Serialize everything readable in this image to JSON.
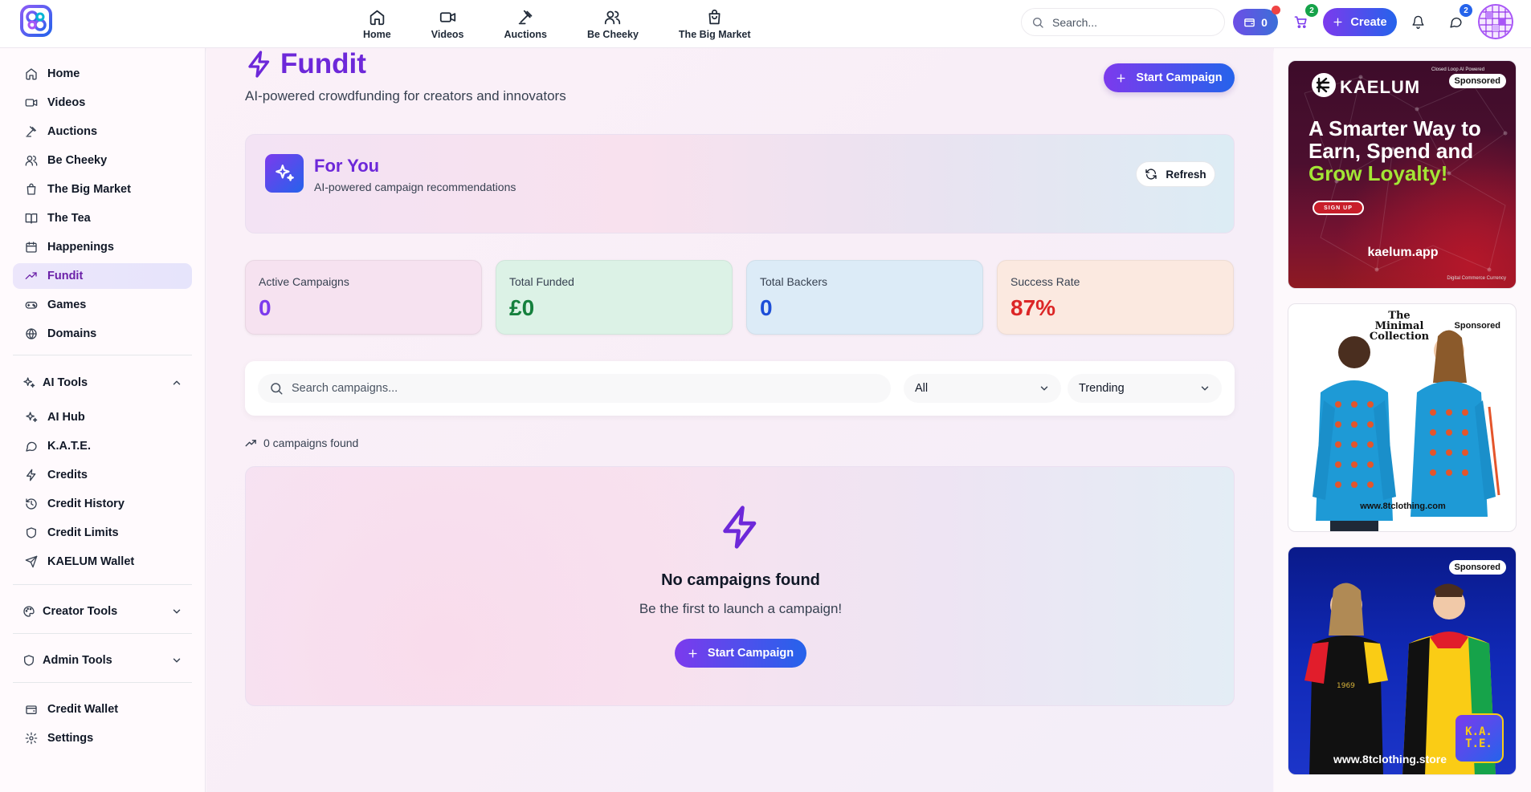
{
  "topbar": {
    "nav": [
      {
        "label": "Home",
        "icon": "home-icon"
      },
      {
        "label": "Videos",
        "icon": "video-icon"
      },
      {
        "label": "Auctions",
        "icon": "gavel-icon"
      },
      {
        "label": "Be Cheeky",
        "icon": "users-icon"
      },
      {
        "label": "The Big Market",
        "icon": "shopping-bag-icon"
      }
    ],
    "search_placeholder": "Search...",
    "wallet_count": "0",
    "cart_badge": "2",
    "create_label": "Create",
    "messages_badge": "2"
  },
  "sidebar": {
    "items": [
      {
        "label": "Home"
      },
      {
        "label": "Videos"
      },
      {
        "label": "Auctions"
      },
      {
        "label": "Be Cheeky"
      },
      {
        "label": "The Big Market"
      },
      {
        "label": "The Tea"
      },
      {
        "label": "Happenings"
      },
      {
        "label": "Fundit",
        "active": true
      },
      {
        "label": "Games"
      },
      {
        "label": "Domains"
      }
    ],
    "ai_tools": {
      "label": "AI Tools",
      "items": [
        {
          "label": "AI Hub"
        },
        {
          "label": "K.A.T.E."
        },
        {
          "label": "Credits"
        },
        {
          "label": "Credit History"
        },
        {
          "label": "Credit Limits"
        },
        {
          "label": "KAELUM Wallet"
        }
      ]
    },
    "creator_tools": {
      "label": "Creator Tools"
    },
    "admin_tools": {
      "label": "Admin Tools"
    },
    "footer": [
      {
        "label": "Credit Wallet"
      },
      {
        "label": "Settings"
      }
    ]
  },
  "main": {
    "title": "Fundit",
    "subtitle": "AI-powered crowdfunding for creators and innovators",
    "start_campaign_label": "Start Campaign",
    "for_you": {
      "title": "For You",
      "subtitle": "AI-powered campaign recommendations",
      "refresh_label": "Refresh"
    },
    "stats": [
      {
        "label": "Active Campaigns",
        "value": "0",
        "color": "#7c3aed",
        "bg": "#f6e2f0"
      },
      {
        "label": "Total Funded",
        "value": "£0",
        "color": "#15803d",
        "bg": "#dcf2e6"
      },
      {
        "label": "Total Backers",
        "value": "0",
        "color": "#1d4ed8",
        "bg": "#dcebf7"
      },
      {
        "label": "Success Rate",
        "value": "87%",
        "color": "#dc2626",
        "bg": "#fbe9e0"
      }
    ],
    "filters": {
      "search_placeholder": "Search campaigns...",
      "category": "All",
      "sort": "Trending"
    },
    "found_text": "0 campaigns found",
    "empty": {
      "title": "No campaigns found",
      "subtitle": "Be the first to launch a campaign!",
      "button_label": "Start Campaign"
    }
  },
  "ads": {
    "sponsored_label": "Sponsored",
    "ad1": {
      "brand": "KAELUM",
      "tagline": "Closed Loop AI Powered",
      "headline_1": "A Smarter Way to",
      "headline_2": "Earn, Spend and",
      "headline_3": "Grow Loyalty!",
      "cta": "SIGN UP",
      "url": "kaelum.app",
      "footer": "Digital Commerce Currency"
    },
    "ad2": {
      "collection": "The Minimal Collection",
      "url": "www.8tclothing.com"
    },
    "ad3": {
      "url": "www.8tclothing.store"
    },
    "kate_badge": "K.A.T.E."
  },
  "colors": {
    "accent_purple": "#6d28d9",
    "accent_blue": "#2563eb"
  }
}
